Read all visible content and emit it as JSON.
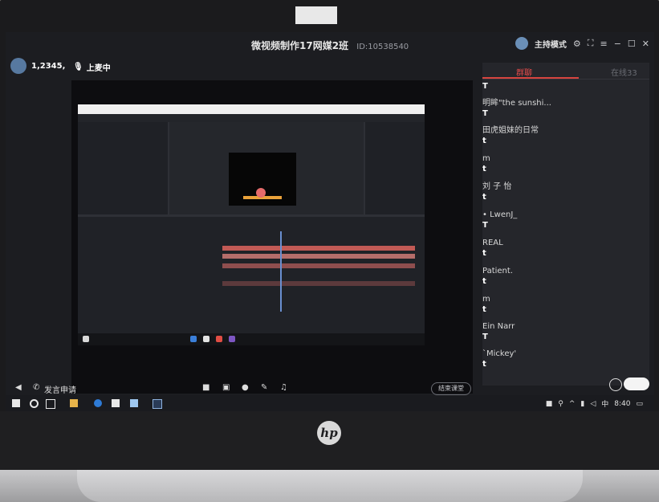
{
  "app": {
    "title": "微视频制作17网媒2班",
    "room_id": "ID:10538540",
    "host_mode": "主持模式"
  },
  "top_left": {
    "user_count": "1,2345,",
    "mic_status": "上麦中"
  },
  "chat": {
    "tabs": [
      {
        "label": "群聊",
        "active": true
      },
      {
        "label": "在线33",
        "active": false
      }
    ],
    "messages": [
      {
        "name": "",
        "text": "T"
      },
      {
        "name": "明眸\"the sunshi...",
        "text": "T"
      },
      {
        "name": "田虎姐妹的日常",
        "text": "t"
      },
      {
        "name": "m",
        "text": "t"
      },
      {
        "name": "刘 子 怡",
        "text": "t"
      },
      {
        "name": "• LwenJ_",
        "text": "T"
      },
      {
        "name": "REAL",
        "text": "t"
      },
      {
        "name": "Patient.",
        "text": "t"
      },
      {
        "name": "m",
        "text": "t"
      },
      {
        "name": "Ein Narr",
        "text": "T"
      },
      {
        "name": "`Mickey'",
        "text": "t"
      }
    ]
  },
  "bottom_bar": {
    "speak_request": "发言申请",
    "end_class": "结束课堂"
  },
  "taskbar": {
    "ime": "中",
    "time": "8:40"
  },
  "colors": {
    "accent_red": "#d7443f",
    "panel_bg": "#25262b",
    "screen_bg": "#1c1d21"
  }
}
